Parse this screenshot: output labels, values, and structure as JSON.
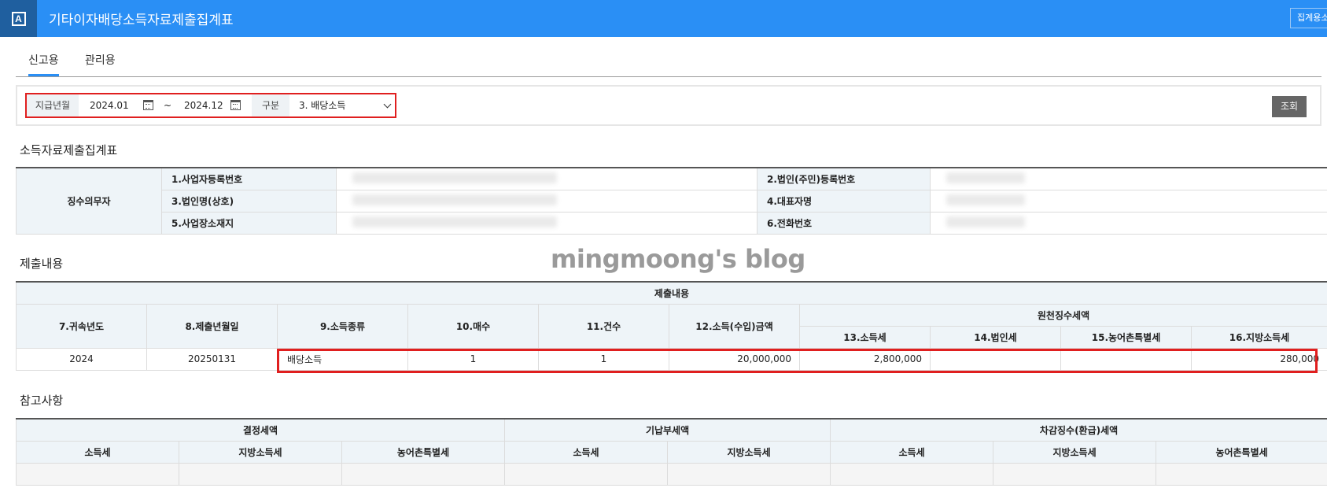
{
  "titlebar": {
    "logo_text": "A",
    "title": "기타이자배당소득자료제출집계표",
    "right_button": "집계용소"
  },
  "tabs": [
    {
      "label": "신고용",
      "active": true
    },
    {
      "label": "관리용",
      "active": false
    }
  ],
  "filter": {
    "period_label": "지급년월",
    "start": "2024.01",
    "separator": "~",
    "end": "2024.12",
    "type_label": "구분",
    "type_value": "3. 배당소득",
    "query_button": "조회"
  },
  "summary": {
    "title": "소득자료제출집계표",
    "row_header": "징수의무자",
    "fields": {
      "biz_reg_no": "1.사업자등록번호",
      "corp_reg_no": "2.법인(주민)등록번호",
      "corp_name": "3.법인명(상호)",
      "rep_name": "4.대표자명",
      "address": "5.사업장소재지",
      "phone": "6.전화번호"
    }
  },
  "watermark": "mingmoong's blog",
  "submission": {
    "title": "제출내용",
    "group_header": "제출내용",
    "withholding_header": "원천징수세액",
    "columns": {
      "year": "7.귀속년도",
      "submit_date": "8.제출년월일",
      "income_type": "9.소득종류",
      "count_sheets": "10.매수",
      "count_cases": "11.건수",
      "amount": "12.소득(수입)금액",
      "income_tax": "13.소득세",
      "corp_tax": "14.법인세",
      "rural_tax": "15.농어촌특별세",
      "local_tax": "16.지방소득세"
    },
    "row": {
      "year": "2024",
      "submit_date": "20250131",
      "income_type": "배당소득",
      "count_sheets": "1",
      "count_cases": "1",
      "amount": "20,000,000",
      "income_tax": "2,800,000",
      "corp_tax": "",
      "rural_tax": "",
      "local_tax": "280,000"
    }
  },
  "reference": {
    "title": "참고사항",
    "groups": {
      "determined": "결정세액",
      "prepaid": "기납부세액",
      "deducted": "차감징수(환급)세액"
    },
    "cols": {
      "income_tax": "소득세",
      "local_tax": "지방소득세",
      "rural_tax": "농어촌특별세"
    }
  }
}
